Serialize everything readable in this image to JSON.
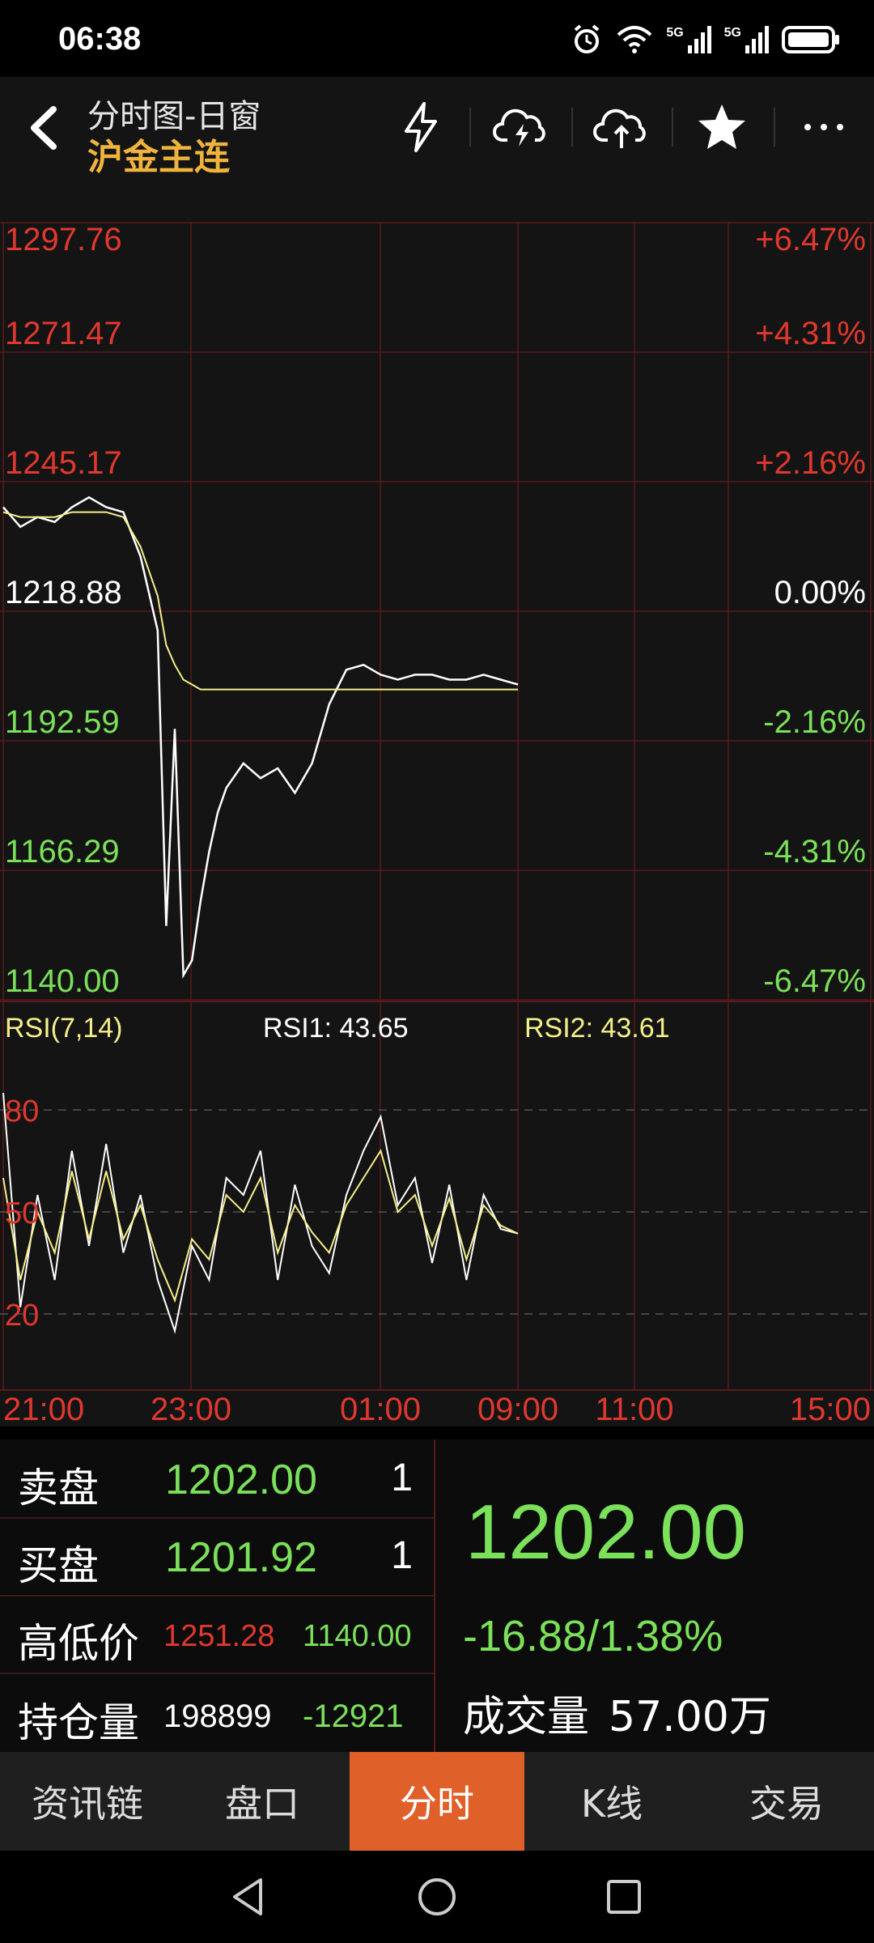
{
  "status_bar": {
    "time": "06:38",
    "signal1": "5G",
    "signal2": "5G"
  },
  "header": {
    "window_title": "分时图-日窗",
    "contract": "沪金主连",
    "icons": [
      "back-arrow-icon",
      "lightning-icon",
      "cloud-sync-icon",
      "cloud-upload-icon",
      "star-icon",
      "more-icon"
    ]
  },
  "chart": {
    "price_levels": [
      "1297.76",
      "1271.47",
      "1245.17",
      "1218.88",
      "1192.59",
      "1166.29",
      "1140.00"
    ],
    "pct_levels": [
      "+6.47%",
      "+4.31%",
      "+2.16%",
      "0.00%",
      "-2.16%",
      "-4.31%",
      "-6.47%"
    ],
    "rsi_label": "RSI(7,14)",
    "rsi1_label": "RSI1: 43.65",
    "rsi2_label": "RSI2: 43.61",
    "rsi_levels": [
      "80",
      "50",
      "20"
    ],
    "time_labels": [
      "21:00",
      "23:00",
      "01:00",
      "09:00",
      "11:00",
      "15:00"
    ]
  },
  "chart_data": [
    {
      "type": "line",
      "title": "",
      "x": [
        0,
        2,
        4,
        6,
        8,
        10,
        12,
        14,
        16,
        18,
        19,
        20,
        21,
        22,
        23,
        24,
        25,
        26,
        28,
        30,
        32,
        34,
        36,
        38,
        40,
        42,
        44,
        46,
        48,
        50,
        52,
        54,
        56,
        58,
        60
      ],
      "series": [
        {
          "name": "price",
          "values": [
            1240,
            1236,
            1238,
            1237,
            1240,
            1242,
            1240,
            1239,
            1230,
            1215,
            1155,
            1195,
            1145,
            1148,
            1160,
            1170,
            1178,
            1183,
            1188,
            1185,
            1187,
            1182,
            1188,
            1200,
            1207,
            1208,
            1206,
            1205,
            1206,
            1206,
            1205,
            1205,
            1206,
            1205,
            1204
          ]
        },
        {
          "name": "average",
          "values": [
            1239,
            1238,
            1238,
            1238,
            1239,
            1239,
            1239,
            1238,
            1232,
            1222,
            1212,
            1208,
            1205,
            1204,
            1203,
            1203,
            1203,
            1203,
            1203,
            1203,
            1203,
            1203,
            1203,
            1203,
            1203,
            1203,
            1203,
            1203,
            1203,
            1203,
            1203,
            1203,
            1203,
            1203,
            1203
          ]
        }
      ],
      "ylim": [
        1140.0,
        1297.76
      ],
      "reference": 1218.88,
      "grid": true
    },
    {
      "type": "line",
      "title": "RSI(7,14)",
      "x": [
        0,
        2,
        4,
        6,
        8,
        10,
        12,
        14,
        16,
        18,
        20,
        22,
        24,
        26,
        28,
        30,
        32,
        34,
        36,
        38,
        40,
        42,
        44,
        46,
        48,
        50,
        52,
        54,
        56,
        58,
        60
      ],
      "series": [
        {
          "name": "RSI1",
          "values": [
            85,
            22,
            55,
            30,
            68,
            40,
            70,
            38,
            55,
            30,
            15,
            40,
            30,
            60,
            55,
            68,
            30,
            58,
            40,
            32,
            55,
            68,
            78,
            52,
            60,
            35,
            58,
            30,
            55,
            45,
            43.65
          ]
        },
        {
          "name": "RSI2",
          "values": [
            60,
            30,
            50,
            38,
            62,
            42,
            62,
            42,
            52,
            36,
            24,
            42,
            36,
            55,
            50,
            60,
            38,
            52,
            44,
            38,
            52,
            60,
            68,
            50,
            55,
            40,
            54,
            36,
            52,
            46,
            43.61
          ]
        }
      ],
      "ylim": [
        0,
        100
      ],
      "reference_lines": [
        80,
        50,
        20
      ]
    }
  ],
  "quote": {
    "ask_label": "卖盘",
    "ask_price": "1202.00",
    "ask_qty": "1",
    "bid_label": "买盘",
    "bid_price": "1201.92",
    "bid_qty": "1",
    "hl_label": "高低价",
    "high": "1251.28",
    "low": "1140.00",
    "oi_label": "持仓量",
    "oi": "198899",
    "oi_change": "-12921",
    "last_price": "1202.00",
    "change": "-16.88/1.38%",
    "volume_label": "成交量",
    "volume": "57.00万"
  },
  "tabs": [
    "资讯链",
    "盘口",
    "分时",
    "K线",
    "交易"
  ],
  "active_tab": 2,
  "colors": {
    "up": "#e0382f",
    "down": "#7be05a",
    "accent": "#f0b43c",
    "active_tab": "#e0602a",
    "grid": "#5a1a1a"
  }
}
